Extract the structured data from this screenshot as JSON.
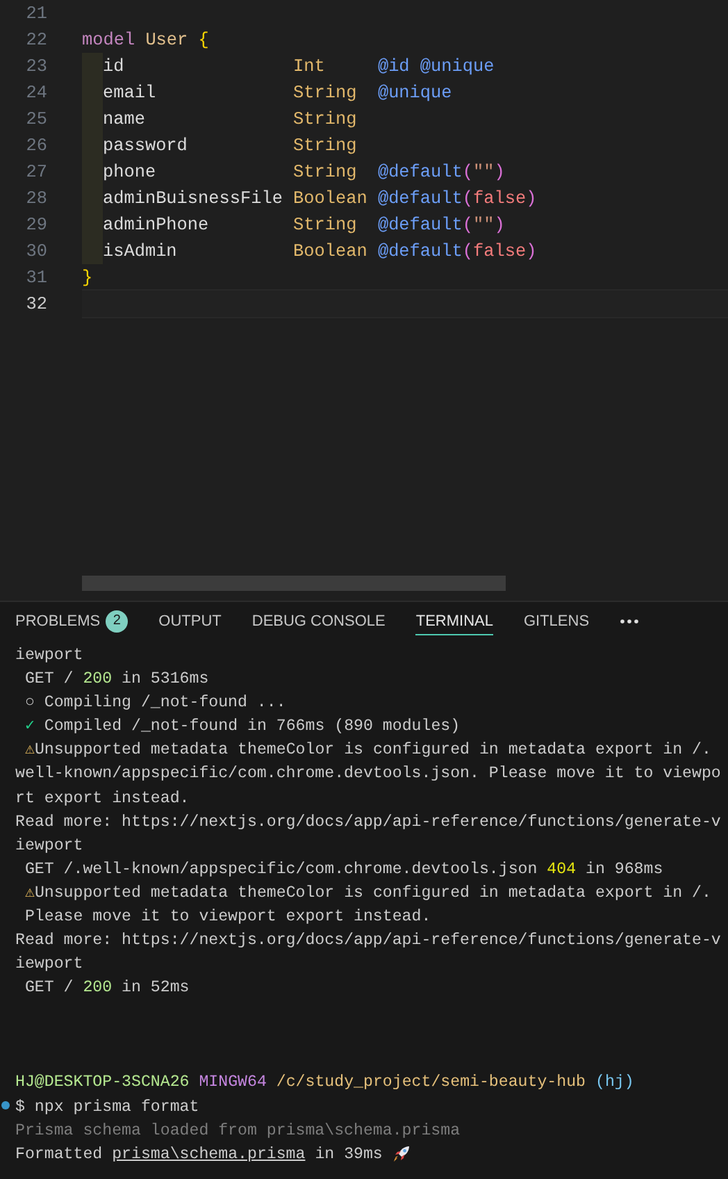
{
  "editor": {
    "lines": [
      {
        "number": "21",
        "kind": "blank",
        "current": false
      },
      {
        "number": "22",
        "kind": "declaration",
        "current": false,
        "tokens": [
          {
            "kind": "keyword",
            "text": "model"
          },
          {
            "kind": "model-name",
            "text": "User"
          },
          {
            "kind": "brace",
            "text": "{"
          }
        ]
      },
      {
        "number": "23",
        "kind": "field",
        "current": false,
        "name": "id",
        "type": "Int",
        "attributes": [
          {
            "kind": "decorator",
            "text": "@id @unique"
          }
        ]
      },
      {
        "number": "24",
        "kind": "field",
        "current": false,
        "name": "email",
        "type": "String",
        "attributes": [
          {
            "kind": "decorator",
            "text": "@unique"
          }
        ]
      },
      {
        "number": "25",
        "kind": "field",
        "current": false,
        "name": "name",
        "type": "String"
      },
      {
        "number": "26",
        "kind": "field",
        "current": false,
        "name": "password",
        "type": "String"
      },
      {
        "number": "27",
        "kind": "field",
        "current": false,
        "name": "phone",
        "type": "String",
        "attributes": [
          {
            "kind": "decorator",
            "text": "@default"
          },
          {
            "kind": "paren",
            "text": "("
          },
          {
            "kind": "string",
            "text": "\"\""
          },
          {
            "kind": "paren",
            "text": ")"
          }
        ]
      },
      {
        "number": "28",
        "kind": "field",
        "current": false,
        "name": "adminBuisnessFile",
        "type": "Boolean",
        "attributes": [
          {
            "kind": "decorator",
            "text": "@default"
          },
          {
            "kind": "paren",
            "text": "("
          },
          {
            "kind": "literal",
            "text": "false"
          },
          {
            "kind": "paren",
            "text": ")"
          }
        ]
      },
      {
        "number": "29",
        "kind": "field",
        "current": false,
        "name": "adminPhone",
        "type": "String",
        "attributes": [
          {
            "kind": "decorator",
            "text": "@default"
          },
          {
            "kind": "paren",
            "text": "("
          },
          {
            "kind": "string",
            "text": "\"\""
          },
          {
            "kind": "paren",
            "text": ")"
          }
        ]
      },
      {
        "number": "30",
        "kind": "field",
        "current": false,
        "name": "isAdmin",
        "type": "Boolean",
        "attributes": [
          {
            "kind": "decorator",
            "text": "@default"
          },
          {
            "kind": "paren",
            "text": "("
          },
          {
            "kind": "literal",
            "text": "false"
          },
          {
            "kind": "paren",
            "text": ")"
          }
        ]
      },
      {
        "number": "31",
        "kind": "declaration",
        "current": false,
        "tokens": [
          {
            "kind": "brace",
            "text": "}"
          }
        ]
      },
      {
        "number": "32",
        "kind": "blank",
        "current": true
      }
    ]
  },
  "panel": {
    "tabs": [
      {
        "label": "PROBLEMS",
        "selected": false,
        "badge": "2"
      },
      {
        "label": "OUTPUT",
        "selected": false
      },
      {
        "label": "DEBUG CONSOLE",
        "selected": false
      },
      {
        "label": "TERMINAL",
        "selected": true
      },
      {
        "label": "GITLENS",
        "selected": false
      }
    ]
  },
  "terminal": {
    "output": [
      {
        "segments": [
          {
            "kind": "plain",
            "text": "iewport"
          }
        ]
      },
      {
        "segments": [
          {
            "kind": "plain",
            "text": " GET / "
          },
          {
            "kind": "ok",
            "text": "200"
          },
          {
            "kind": "plain",
            "text": " in 5316ms"
          }
        ]
      },
      {
        "segments": [
          {
            "kind": "plain",
            "text": " ○ Compiling /_not-found ..."
          }
        ]
      },
      {
        "segments": [
          {
            "kind": "check",
            "text": " ✓"
          },
          {
            "kind": "plain",
            "text": " Compiled /_not-found in 766ms (890 modules)"
          }
        ]
      },
      {
        "segments": [
          {
            "kind": "warn",
            "text": " ⚠"
          },
          {
            "kind": "plain",
            "text": "Unsupported metadata themeColor is configured in metadata export in /."
          }
        ]
      },
      {
        "segments": [
          {
            "kind": "plain",
            "text": "well-known/appspecific/com.chrome.devtools.json. Please move it to viewpo"
          }
        ]
      },
      {
        "segments": [
          {
            "kind": "plain",
            "text": "rt export instead."
          }
        ]
      },
      {
        "segments": [
          {
            "kind": "plain",
            "text": "Read more: https://nextjs.org/docs/app/api-reference/functions/generate-v"
          }
        ]
      },
      {
        "segments": [
          {
            "kind": "plain",
            "text": "iewport"
          }
        ]
      },
      {
        "segments": [
          {
            "kind": "plain",
            "text": " GET /.well-known/appspecific/com.chrome.devtools.json "
          },
          {
            "kind": "notfound",
            "text": "404"
          },
          {
            "kind": "plain",
            "text": " in 968ms"
          }
        ]
      },
      {
        "segments": [
          {
            "kind": "warn",
            "text": " ⚠"
          },
          {
            "kind": "plain",
            "text": "Unsupported metadata themeColor is configured in metadata export in /."
          }
        ]
      },
      {
        "segments": [
          {
            "kind": "plain",
            "text": " Please move it to viewport export instead."
          }
        ]
      },
      {
        "segments": [
          {
            "kind": "plain",
            "text": "Read more: https://nextjs.org/docs/app/api-reference/functions/generate-v"
          }
        ]
      },
      {
        "segments": [
          {
            "kind": "plain",
            "text": "iewport"
          }
        ]
      },
      {
        "segments": [
          {
            "kind": "plain",
            "text": " GET / "
          },
          {
            "kind": "ok",
            "text": "200"
          },
          {
            "kind": "plain",
            "text": " in 52ms"
          }
        ]
      }
    ],
    "prompt": {
      "user": "HJ@DESKTOP-3SCNA26",
      "system": "MINGW64",
      "path": "/c/study_project/semi-beauty-hub",
      "branch": "(hj)"
    },
    "command": "$ npx prisma format",
    "result": [
      {
        "segments": [
          {
            "kind": "dim",
            "text": "Prisma schema loaded from prisma\\schema.prisma"
          }
        ]
      },
      {
        "segments": [
          {
            "kind": "plain",
            "text": "Formatted "
          },
          {
            "kind": "link",
            "text": "prisma\\schema.prisma"
          },
          {
            "kind": "plain",
            "text": " in 39ms"
          }
        ],
        "kind": "success"
      }
    ]
  }
}
